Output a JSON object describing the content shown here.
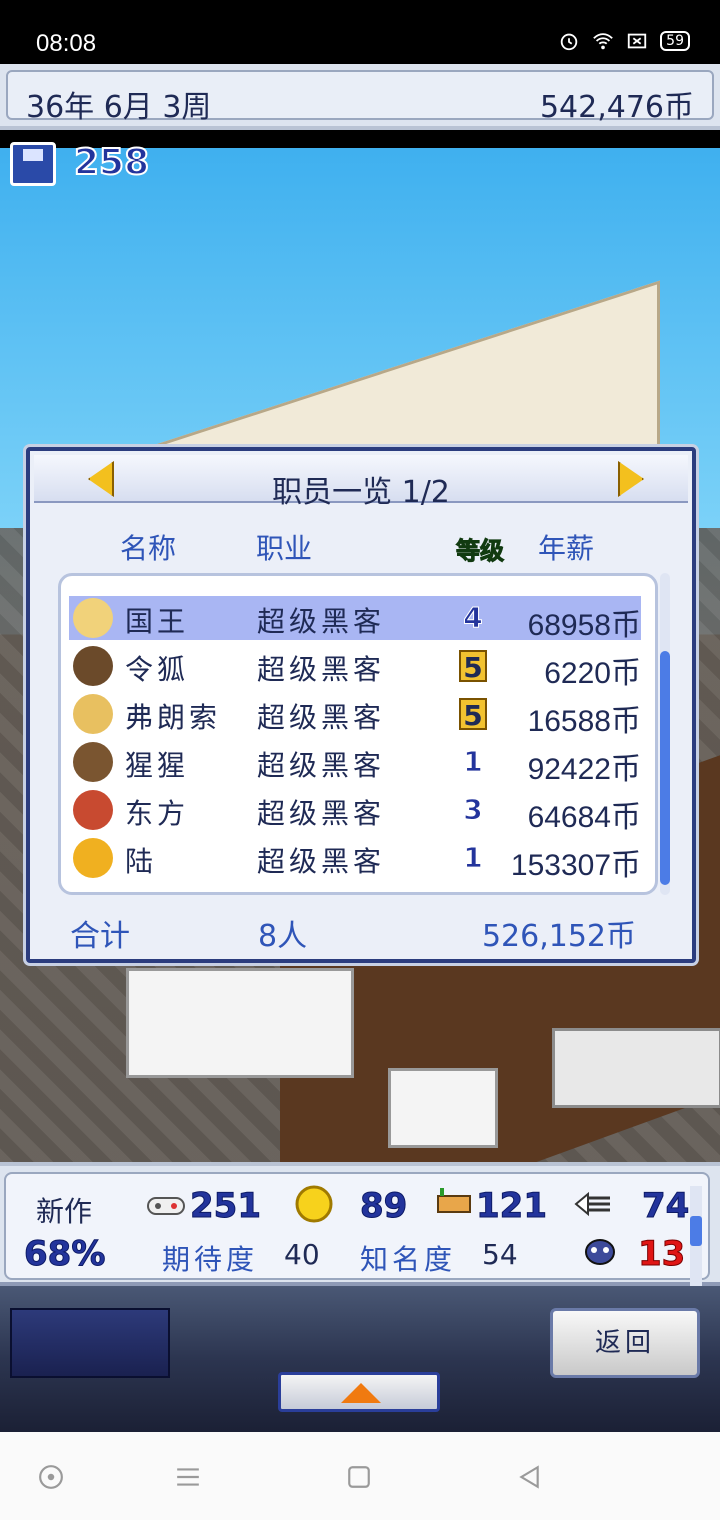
{
  "status_bar": {
    "time": "08:08",
    "battery": "59"
  },
  "top_bar": {
    "date": "36年 6月 3周",
    "money": "542,476币"
  },
  "save": {
    "count": "258"
  },
  "panel": {
    "title": "职员一览 1/2",
    "headers": {
      "name": "名称",
      "job": "职业",
      "level": "等级",
      "salary": "年薪"
    },
    "rows": [
      {
        "name": "国王",
        "job": "超级黑客",
        "level": "4",
        "level_style": "blue",
        "salary": "68958币",
        "selected": true,
        "avatar_color": "#f1d27a"
      },
      {
        "name": "令狐",
        "job": "超级黑客",
        "level": "5",
        "level_style": "gold",
        "salary": "6220币",
        "selected": false,
        "avatar_color": "#6b4a2a"
      },
      {
        "name": "弗朗索",
        "job": "超级黑客",
        "level": "5",
        "level_style": "gold",
        "salary": "16588币",
        "selected": false,
        "avatar_color": "#e8c060"
      },
      {
        "name": "猩猩",
        "job": "超级黑客",
        "level": "1",
        "level_style": "blue",
        "salary": "92422币",
        "selected": false,
        "avatar_color": "#7a5530"
      },
      {
        "name": "东方",
        "job": "超级黑客",
        "level": "3",
        "level_style": "blue",
        "salary": "64684币",
        "selected": false,
        "avatar_color": "#c84a30"
      },
      {
        "name": "陆",
        "job": "超级黑客",
        "level": "1",
        "level_style": "blue",
        "salary": "153307币",
        "selected": false,
        "avatar_color": "#f0b020"
      }
    ],
    "total_label": "合计",
    "total_count": "8人",
    "total_money": "526,152币"
  },
  "stats": {
    "new_work_label": "新作",
    "progress": "68%",
    "controller_value": "251",
    "coin_value": "89",
    "bed_value": "121",
    "fish_value": "74",
    "expectation_label": "期待度",
    "expectation_value": "40",
    "fame_label": "知名度",
    "fame_value": "54",
    "bug_value": "13"
  },
  "controls": {
    "back_label": "返回"
  }
}
